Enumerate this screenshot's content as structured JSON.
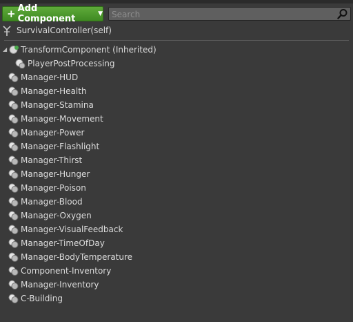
{
  "toolbar": {
    "add_component_label": "Add Component",
    "search_placeholder": "Search"
  },
  "self_item": {
    "label": "SurvivalController(self)"
  },
  "tree": {
    "root": {
      "label": "TransformComponent (Inherited)",
      "expanded": true
    },
    "child": {
      "label": "PlayerPostProcessing"
    },
    "items": [
      {
        "label": "Manager-HUD"
      },
      {
        "label": "Manager-Health"
      },
      {
        "label": "Manager-Stamina"
      },
      {
        "label": "Manager-Movement"
      },
      {
        "label": "Manager-Power"
      },
      {
        "label": "Manager-Flashlight"
      },
      {
        "label": "Manager-Thirst"
      },
      {
        "label": "Manager-Hunger"
      },
      {
        "label": "Manager-Poison"
      },
      {
        "label": "Manager-Blood"
      },
      {
        "label": "Manager-Oxygen"
      },
      {
        "label": "Manager-VisualFeedback"
      },
      {
        "label": "Manager-TimeOfDay"
      },
      {
        "label": "Manager-BodyTemperature"
      },
      {
        "label": "Component-Inventory"
      },
      {
        "label": "Manager-Inventory"
      },
      {
        "label": "C-Building"
      }
    ]
  },
  "colors": {
    "panel_bg": "#3a3a3a",
    "add_button": "#4c9a2a",
    "search_bg": "#5f5f5f",
    "text": "#dcdcdc"
  }
}
